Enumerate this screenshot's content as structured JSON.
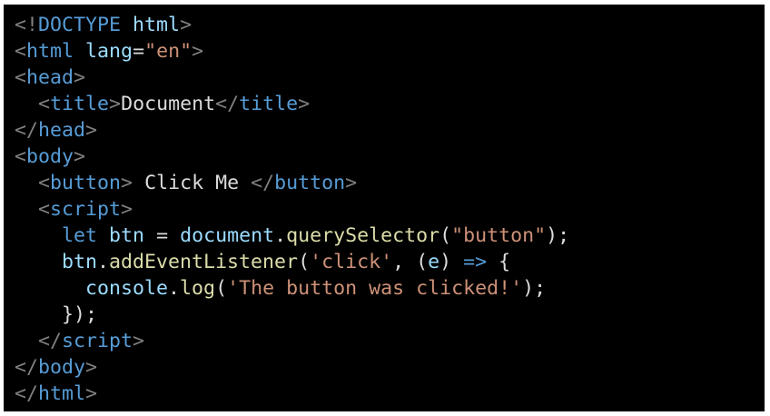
{
  "colors": {
    "background": "#000000",
    "page": "#ffffff",
    "punctuation": "#808080",
    "tag": "#569cd6",
    "attribute": "#9cdcfe",
    "string": "#ce9178",
    "keyword": "#569cd6",
    "variable": "#9cdcfe",
    "function": "#dcdcaa",
    "text": "#dcdcdc"
  },
  "code": {
    "lines": [
      [
        {
          "t": "punct",
          "v": "<!"
        },
        {
          "t": "tag",
          "v": "DOCTYPE"
        },
        {
          "t": "text",
          "v": " "
        },
        {
          "t": "attr",
          "v": "html"
        },
        {
          "t": "punct",
          "v": ">"
        }
      ],
      [
        {
          "t": "punct",
          "v": "<"
        },
        {
          "t": "tag",
          "v": "html"
        },
        {
          "t": "text",
          "v": " "
        },
        {
          "t": "attr",
          "v": "lang"
        },
        {
          "t": "text",
          "v": "="
        },
        {
          "t": "str",
          "v": "\"en\""
        },
        {
          "t": "punct",
          "v": ">"
        }
      ],
      [
        {
          "t": "punct",
          "v": "<"
        },
        {
          "t": "tag",
          "v": "head"
        },
        {
          "t": "punct",
          "v": ">"
        }
      ],
      [
        {
          "t": "text",
          "v": "  "
        },
        {
          "t": "punct",
          "v": "<"
        },
        {
          "t": "tag",
          "v": "title"
        },
        {
          "t": "punct",
          "v": ">"
        },
        {
          "t": "text",
          "v": "Document"
        },
        {
          "t": "punct",
          "v": "</"
        },
        {
          "t": "tag",
          "v": "title"
        },
        {
          "t": "punct",
          "v": ">"
        }
      ],
      [
        {
          "t": "punct",
          "v": "</"
        },
        {
          "t": "tag",
          "v": "head"
        },
        {
          "t": "punct",
          "v": ">"
        }
      ],
      [
        {
          "t": "punct",
          "v": "<"
        },
        {
          "t": "tag",
          "v": "body"
        },
        {
          "t": "punct",
          "v": ">"
        }
      ],
      [
        {
          "t": "text",
          "v": "  "
        },
        {
          "t": "punct",
          "v": "<"
        },
        {
          "t": "tag",
          "v": "button"
        },
        {
          "t": "punct",
          "v": ">"
        },
        {
          "t": "text",
          "v": " Click Me "
        },
        {
          "t": "punct",
          "v": "</"
        },
        {
          "t": "tag",
          "v": "button"
        },
        {
          "t": "punct",
          "v": ">"
        }
      ],
      [
        {
          "t": "text",
          "v": "  "
        },
        {
          "t": "punct",
          "v": "<"
        },
        {
          "t": "tag",
          "v": "script"
        },
        {
          "t": "punct",
          "v": ">"
        }
      ],
      [
        {
          "t": "text",
          "v": "    "
        },
        {
          "t": "kw",
          "v": "let"
        },
        {
          "t": "text",
          "v": " "
        },
        {
          "t": "var",
          "v": "btn"
        },
        {
          "t": "text",
          "v": " = "
        },
        {
          "t": "var",
          "v": "document"
        },
        {
          "t": "text",
          "v": "."
        },
        {
          "t": "fn",
          "v": "querySelector"
        },
        {
          "t": "text",
          "v": "("
        },
        {
          "t": "str",
          "v": "\"button\""
        },
        {
          "t": "text",
          "v": ");"
        }
      ],
      [
        {
          "t": "text",
          "v": "    "
        },
        {
          "t": "var",
          "v": "btn"
        },
        {
          "t": "text",
          "v": "."
        },
        {
          "t": "fn",
          "v": "addEventListener"
        },
        {
          "t": "text",
          "v": "("
        },
        {
          "t": "str",
          "v": "'click'"
        },
        {
          "t": "text",
          "v": ", ("
        },
        {
          "t": "var",
          "v": "e"
        },
        {
          "t": "text",
          "v": ") "
        },
        {
          "t": "kw",
          "v": "=>"
        },
        {
          "t": "text",
          "v": " {"
        }
      ],
      [
        {
          "t": "text",
          "v": "      "
        },
        {
          "t": "var",
          "v": "console"
        },
        {
          "t": "text",
          "v": "."
        },
        {
          "t": "fn",
          "v": "log"
        },
        {
          "t": "text",
          "v": "("
        },
        {
          "t": "str",
          "v": "'The button was clicked!'"
        },
        {
          "t": "text",
          "v": ");"
        }
      ],
      [
        {
          "t": "text",
          "v": "    });"
        }
      ],
      [
        {
          "t": "text",
          "v": "  "
        },
        {
          "t": "punct",
          "v": "</"
        },
        {
          "t": "tag",
          "v": "script"
        },
        {
          "t": "punct",
          "v": ">"
        }
      ],
      [
        {
          "t": "punct",
          "v": "</"
        },
        {
          "t": "tag",
          "v": "body"
        },
        {
          "t": "punct",
          "v": ">"
        }
      ],
      [
        {
          "t": "punct",
          "v": "</"
        },
        {
          "t": "tag",
          "v": "html"
        },
        {
          "t": "punct",
          "v": ">"
        }
      ]
    ]
  }
}
